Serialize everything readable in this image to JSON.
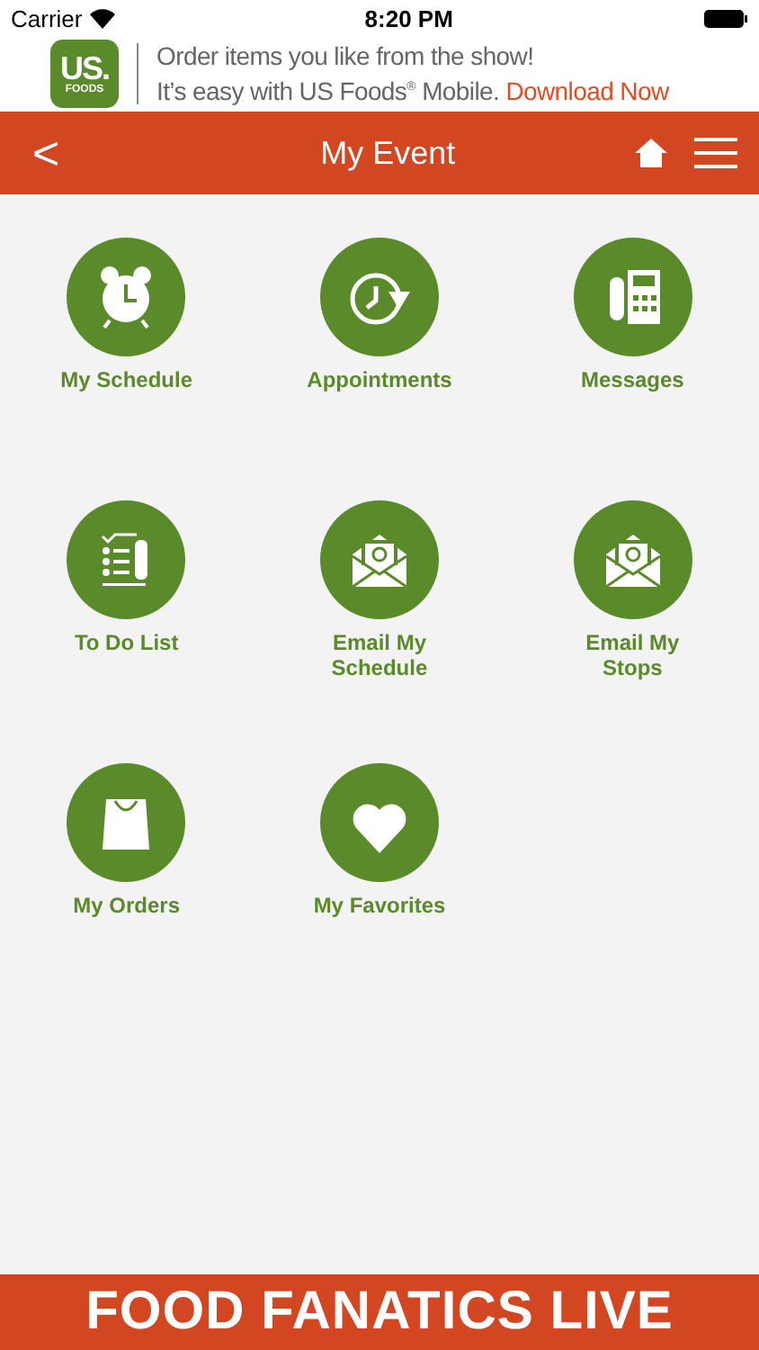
{
  "status_bar": {
    "carrier": "Carrier",
    "time": "8:20 PM"
  },
  "ad_banner": {
    "logo_top": "US.",
    "logo_bottom": "FOODS",
    "line1": "Order items you like from the show!",
    "line2": "It’s easy with US Foods$^{®}$ Mobile.",
    "link": "Download Now"
  },
  "nav_bar": {
    "back": "<",
    "title": "My Event"
  },
  "tiles": [
    {
      "kind": "clock",
      "label": "My Schedule"
    },
    {
      "kind": "appointment",
      "label": "Appointments"
    },
    {
      "kind": "phone",
      "label": "Messages"
    },
    {
      "kind": "todo",
      "label": "To Do List"
    },
    {
      "kind": "email",
      "label": "Email My Schedule"
    },
    {
      "kind": "email",
      "label": "Email My Stops"
    },
    {
      "kind": "bag",
      "label": "My Orders"
    },
    {
      "kind": "heart",
      "label": "My Favorites"
    }
  ],
  "footer": {
    "brand": "FOOD FANATICS LIVE"
  }
}
